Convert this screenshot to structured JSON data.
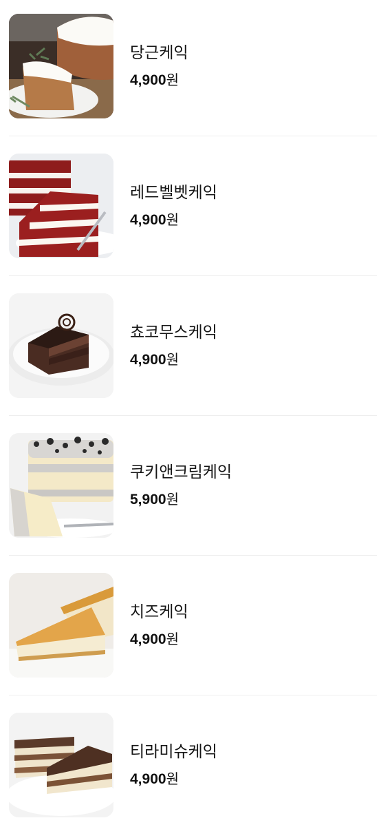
{
  "menu": {
    "items": [
      {
        "name": "당근케익",
        "price": "4,900",
        "currency": "원",
        "image": "carrot-cake-photo"
      },
      {
        "name": "레드벨벳케익",
        "price": "4,900",
        "currency": "원",
        "image": "red-velvet-cake-photo"
      },
      {
        "name": "쵸코무스케익",
        "price": "4,900",
        "currency": "원",
        "image": "chocolate-mousse-cake-photo"
      },
      {
        "name": "쿠키앤크림케익",
        "price": "5,900",
        "currency": "원",
        "image": "cookies-and-cream-cake-photo"
      },
      {
        "name": "치즈케익",
        "price": "4,900",
        "currency": "원",
        "image": "cheesecake-photo"
      },
      {
        "name": "티라미슈케익",
        "price": "4,900",
        "currency": "원",
        "image": "tiramisu-cake-photo"
      }
    ]
  },
  "colors": {
    "text": "#111111",
    "divider": "#eeeeee",
    "thumb_background": "#f3f3f3"
  }
}
